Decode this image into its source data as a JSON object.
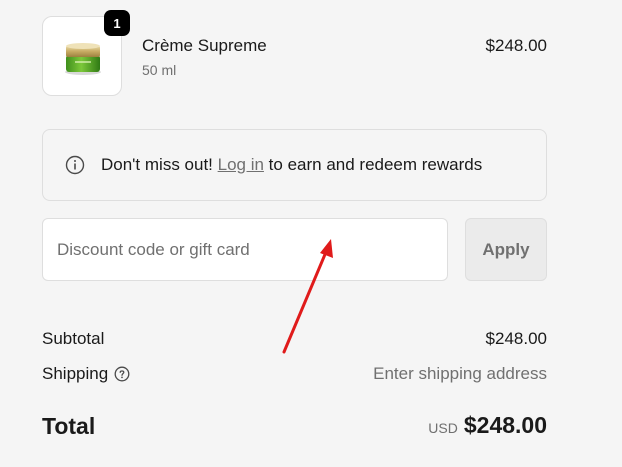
{
  "product": {
    "quantity": "1",
    "name": "Crème Supreme",
    "variant": "50 ml",
    "price": "$248.00",
    "image_icon": "cream-jar-icon"
  },
  "rewards": {
    "lead": "Don't miss out! ",
    "link": "Log in",
    "trail": " to earn and redeem rewards",
    "icon": "info-icon"
  },
  "discount": {
    "placeholder": "Discount code or gift card",
    "value": "",
    "apply_label": "Apply"
  },
  "summary": {
    "subtotal_label": "Subtotal",
    "subtotal_value": "$248.00",
    "shipping_label": "Shipping",
    "shipping_icon": "help-circle-icon",
    "shipping_value": "Enter shipping address",
    "total_label": "Total",
    "total_currency": "USD",
    "total_value": "$248.00"
  },
  "annotation": {
    "type": "arrow",
    "color": "#e01b1b"
  }
}
